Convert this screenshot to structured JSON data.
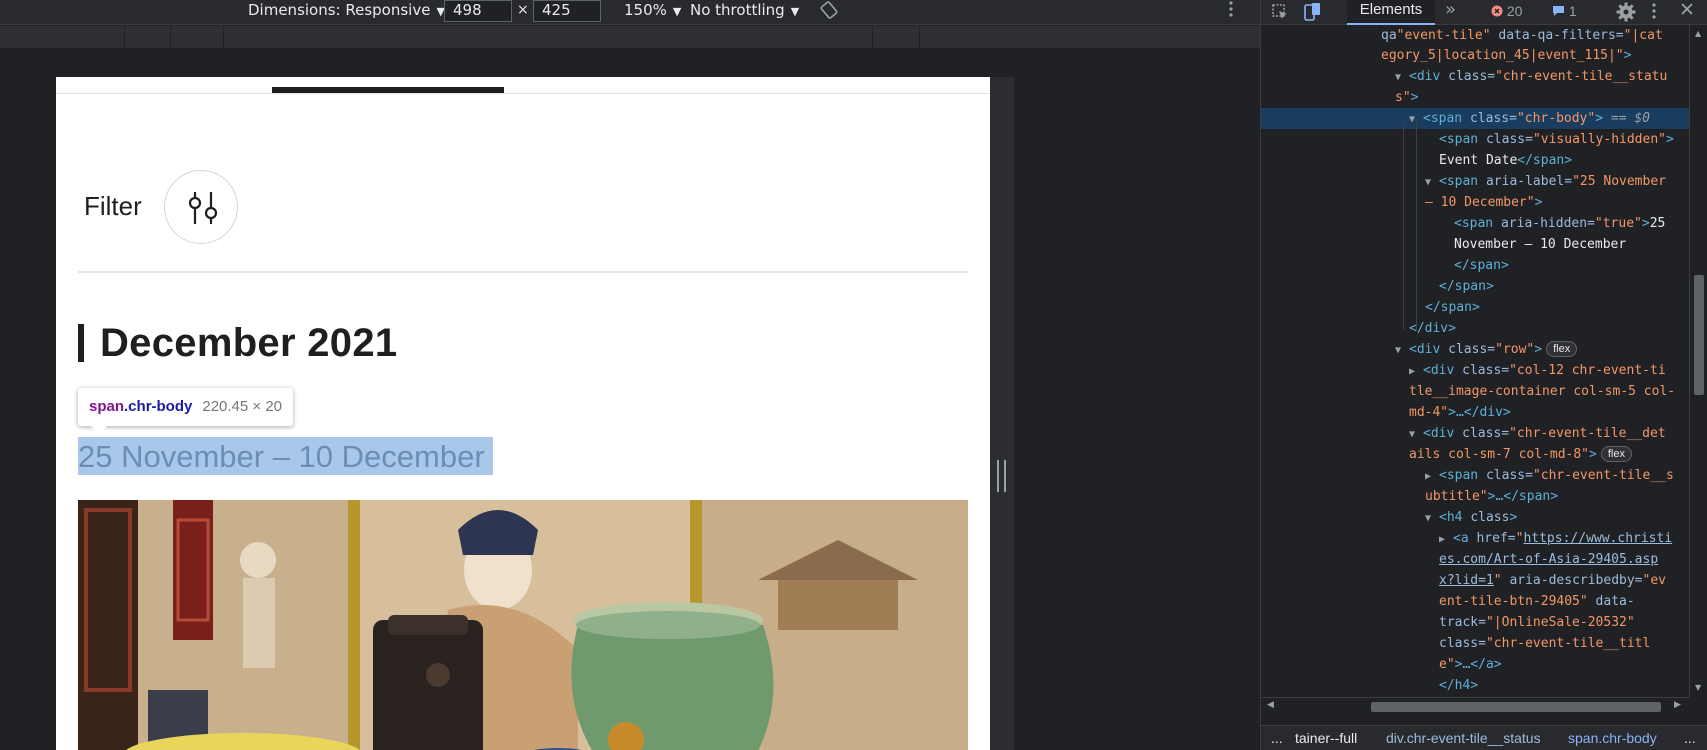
{
  "device_toolbar": {
    "dimensions": "Dimensions: Responsive",
    "width": "498",
    "height": "425",
    "times": "×",
    "zoom": "150%",
    "throttling": "No throttling"
  },
  "page": {
    "filter_label": "Filter",
    "month_heading": "December 2021",
    "date_range": "25 November – 10 December",
    "tooltip": {
      "tag": "span",
      "cls": ".chr-body",
      "size": "220.45 × 20"
    }
  },
  "devtools": {
    "tabs": {
      "elements": "Elements",
      "more": "»"
    },
    "errors_count": "20",
    "messages_count": "1",
    "flex_badge": "flex",
    "breadcrumbs": {
      "ellipsis": "...",
      "item1": "tainer--full",
      "item2": "div.chr-event-tile__status",
      "item3": "span.chr-body",
      "trailing": "..."
    },
    "dom": {
      "l1_an": "qa",
      "l1_av": "\"event-tile\"",
      "l1_an2": " data-qa-filters=",
      "l1_av2": "\"|cat",
      "l2_av": "egory_5|location_45|event_115|\"",
      "l2_t": ">",
      "l3_t": "<div ",
      "l3_an": "class=",
      "l3_av": "\"chr-event-tile__statu",
      "l4_av": "s\"",
      "l4_t": ">",
      "l5_t": "<span ",
      "l5_an": "class=",
      "l5_av": "\"chr-body\"",
      "l5_t2": ">",
      "l5_tx": " == $0",
      "l6_t": "<span ",
      "l6_an": "class=",
      "l6_av": "\"visually-hidden\"",
      "l6_t2": ">",
      "l7_tx": "Event Date",
      "l7_t": "</span>",
      "l8_t": "<span ",
      "l8_an": "aria-label=",
      "l8_av": "\"25 November",
      "l9_av": "– 10 December\"",
      "l9_t": ">",
      "l10_t": "<span ",
      "l10_an": "aria-hidden=",
      "l10_av": "\"true\"",
      "l10_t2": ">",
      "l10_tx": "25",
      "l11_tx": "November – 10 December",
      "l12_t": "</span>",
      "l13_t": "</span>",
      "l14_t": "</span>",
      "l15_t": "</div>",
      "l16_t": "<div ",
      "l16_an": "class=",
      "l16_av": "\"row\"",
      "l16_t2": ">",
      "l17_t": "<div ",
      "l17_an": "class=",
      "l17_av": "\"col-12 chr-event-ti",
      "l18_av": "tle__image-container col-sm-5 col-",
      "l19_av": "md-4\"",
      "l19_t": ">…</div>",
      "l20_t": "<div ",
      "l20_an": "class=",
      "l20_av": "\"chr-event-tile__det",
      "l21_av": "ails col-sm-7 col-md-8\"",
      "l21_t": ">",
      "l22_t": "<span ",
      "l22_an": "class=",
      "l22_av": "\"chr-event-tile__s",
      "l23_av": "ubtitle\"",
      "l23_t": ">…</span>",
      "l24_t": "<h4 ",
      "l24_an": "class",
      "l24_t2": ">",
      "l25_t": "<a ",
      "l25_an": "href=",
      "l25_q": "\"",
      "l25_lk": "https://www.christi",
      "l26_lk": "es.com/Art-of-Asia-29405.asp",
      "l27_lk": "x?lid=1",
      "l27_q": "\"",
      "l27_an": " aria-describedby=",
      "l27_av": "\"ev",
      "l28_av": "ent-tile-btn-29405\"",
      "l28_an": " data-",
      "l29_an": "track=",
      "l29_av": "\"|OnlineSale-20532\"",
      "l30_an": "class=",
      "l30_av": "\"chr-event-tile__titl",
      "l31_av": "e\"",
      "l31_t": ">…</a>",
      "l32_t": "</h4>"
    }
  }
}
